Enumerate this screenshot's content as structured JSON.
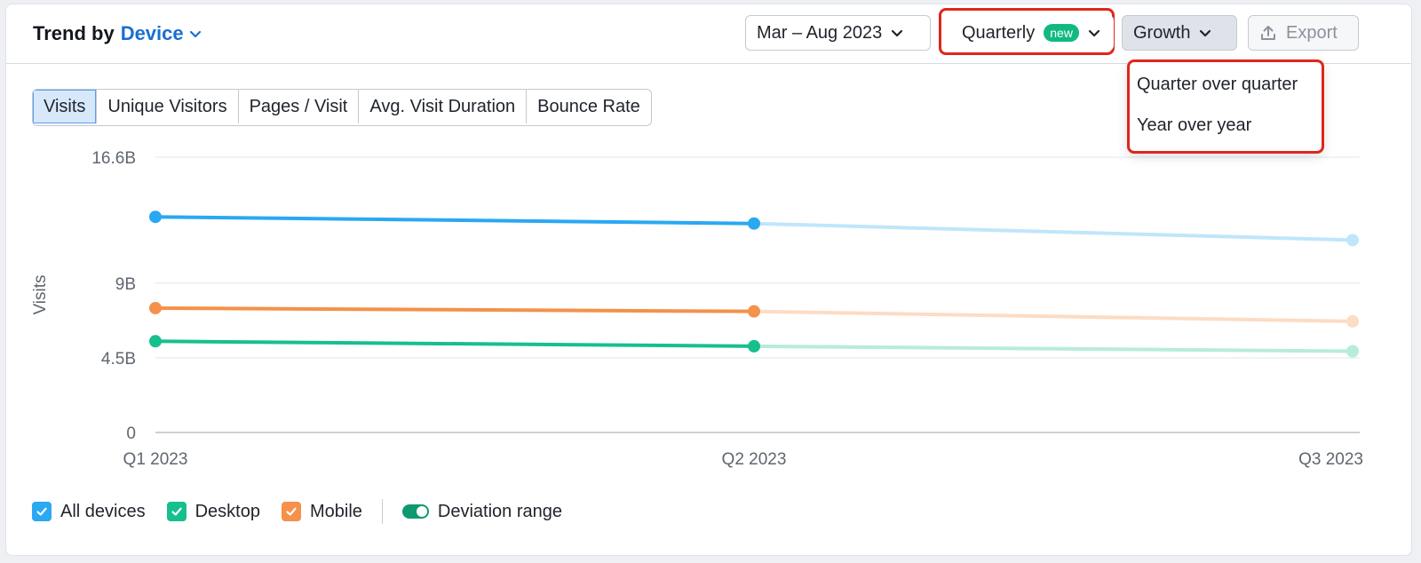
{
  "header": {
    "title_prefix": "Trend by",
    "title_dimension": "Device",
    "date_range": "Mar – Aug 2023",
    "granularity": "Quarterly",
    "granularity_badge": "new",
    "mode": "Growth",
    "export_label": "Export"
  },
  "growth_menu": {
    "items": [
      "Quarter over quarter",
      "Year over year"
    ]
  },
  "metric_tabs": [
    {
      "label": "Visits",
      "active": true
    },
    {
      "label": "Unique Visitors",
      "active": false
    },
    {
      "label": "Pages / Visit",
      "active": false
    },
    {
      "label": "Avg. Visit Duration",
      "active": false
    },
    {
      "label": "Bounce Rate",
      "active": false
    }
  ],
  "legend": {
    "items": [
      {
        "label": "All devices",
        "color": "#2aa8f2",
        "checked": true
      },
      {
        "label": "Desktop",
        "color": "#17bf8e",
        "checked": true
      },
      {
        "label": "Mobile",
        "color": "#f5914a",
        "checked": true
      }
    ],
    "toggle_label": "Deviation range",
    "toggle_on": true
  },
  "colors": {
    "accent_blue": "#1a6fd1",
    "highlight_red": "#e0261c",
    "badge_green": "#11b980"
  },
  "chart_data": {
    "type": "line",
    "ylabel": "Visits",
    "ylim": [
      0,
      16.6
    ],
    "y_ticks": [
      "16.6B",
      "9B",
      "4.5B",
      "0"
    ],
    "y_tick_values": [
      16.6,
      9,
      4.5,
      0
    ],
    "categories": [
      "Q1 2023",
      "Q2 2023",
      "Q3 2023"
    ],
    "projected_from_index": 1,
    "series": [
      {
        "name": "All devices",
        "color": "#2aa8f2",
        "light_color": "#bfe6fb",
        "values": [
          13.0,
          12.6,
          11.6
        ]
      },
      {
        "name": "Mobile",
        "color": "#f5914a",
        "light_color": "#fcdcc4",
        "values": [
          7.5,
          7.3,
          6.7
        ]
      },
      {
        "name": "Desktop",
        "color": "#17bf8e",
        "light_color": "#b8ecd9",
        "values": [
          5.5,
          5.2,
          4.9
        ]
      }
    ],
    "grid": true
  }
}
